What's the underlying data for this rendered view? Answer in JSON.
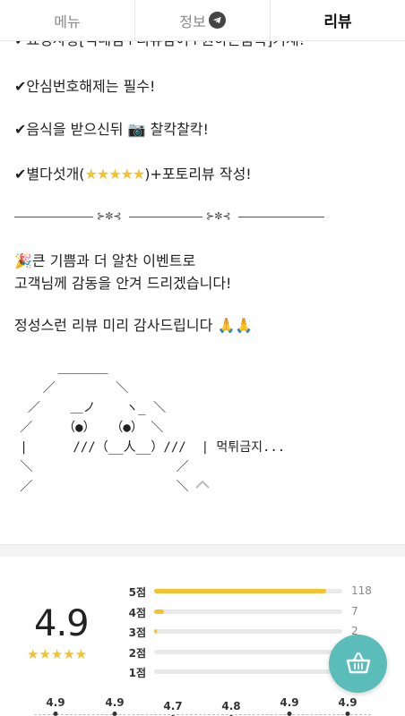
{
  "tabs": [
    {
      "label": "메뉴"
    },
    {
      "label": "정보"
    },
    {
      "label": "리뷰"
    }
  ],
  "notice": {
    "line_cut": "✔요청사항[닉네임+리뷰참여+원하는품목]기재!",
    "line1": "✔안심번호해제는 필수!",
    "line2_a": "✔음식을 받으신뒤 ",
    "line2_camera": "📷",
    "line2_b": " 찰칵찰칵!",
    "line3_a": "✔별다섯개(",
    "line3_stars": "★★★★★",
    "line3_b": ")+포토리뷰 작성!",
    "divider_ornament": "⊱✼⊰",
    "line4_icon": "🎉",
    "line4": "큰 기쁨과 더 알찬 이벤트로",
    "line5": "고객님께 감동을 안겨 드리겠습니다!",
    "line6_a": "정성스런 리뷰 미리 감사드립니다 ",
    "line6_icon": "🙏🙏",
    "ascii_art": "      ＿＿＿＿\n    ／        ＼\n  ／    ＿ノ    ヽ_ ＼\n ／    （●）  （●） ＼\n |      ///（__人__）///  | 먹튀금지...\n ＼                   ／\n ／                   ＼"
  },
  "rating": {
    "average": "4.9",
    "stars": "★★★★★",
    "distribution": [
      {
        "label": "5점",
        "count": "118",
        "fraction": 0.915
      },
      {
        "label": "4점",
        "count": "7",
        "fraction": 0.054
      },
      {
        "label": "3점",
        "count": "2",
        "fraction": 0.016
      },
      {
        "label": "2점",
        "count": "",
        "fraction": 0
      },
      {
        "label": "1점",
        "count": "",
        "fraction": 0
      }
    ],
    "trend": [
      "4.9",
      "4.9",
      "4.7",
      "4.8",
      "4.9",
      "4.9"
    ]
  },
  "colors": {
    "star": "#f1c232",
    "cart_button": "#5bbdba"
  },
  "icons": {
    "telegram": "telegram-icon",
    "collapse": "chevron-up-icon",
    "cart": "basket-icon"
  }
}
